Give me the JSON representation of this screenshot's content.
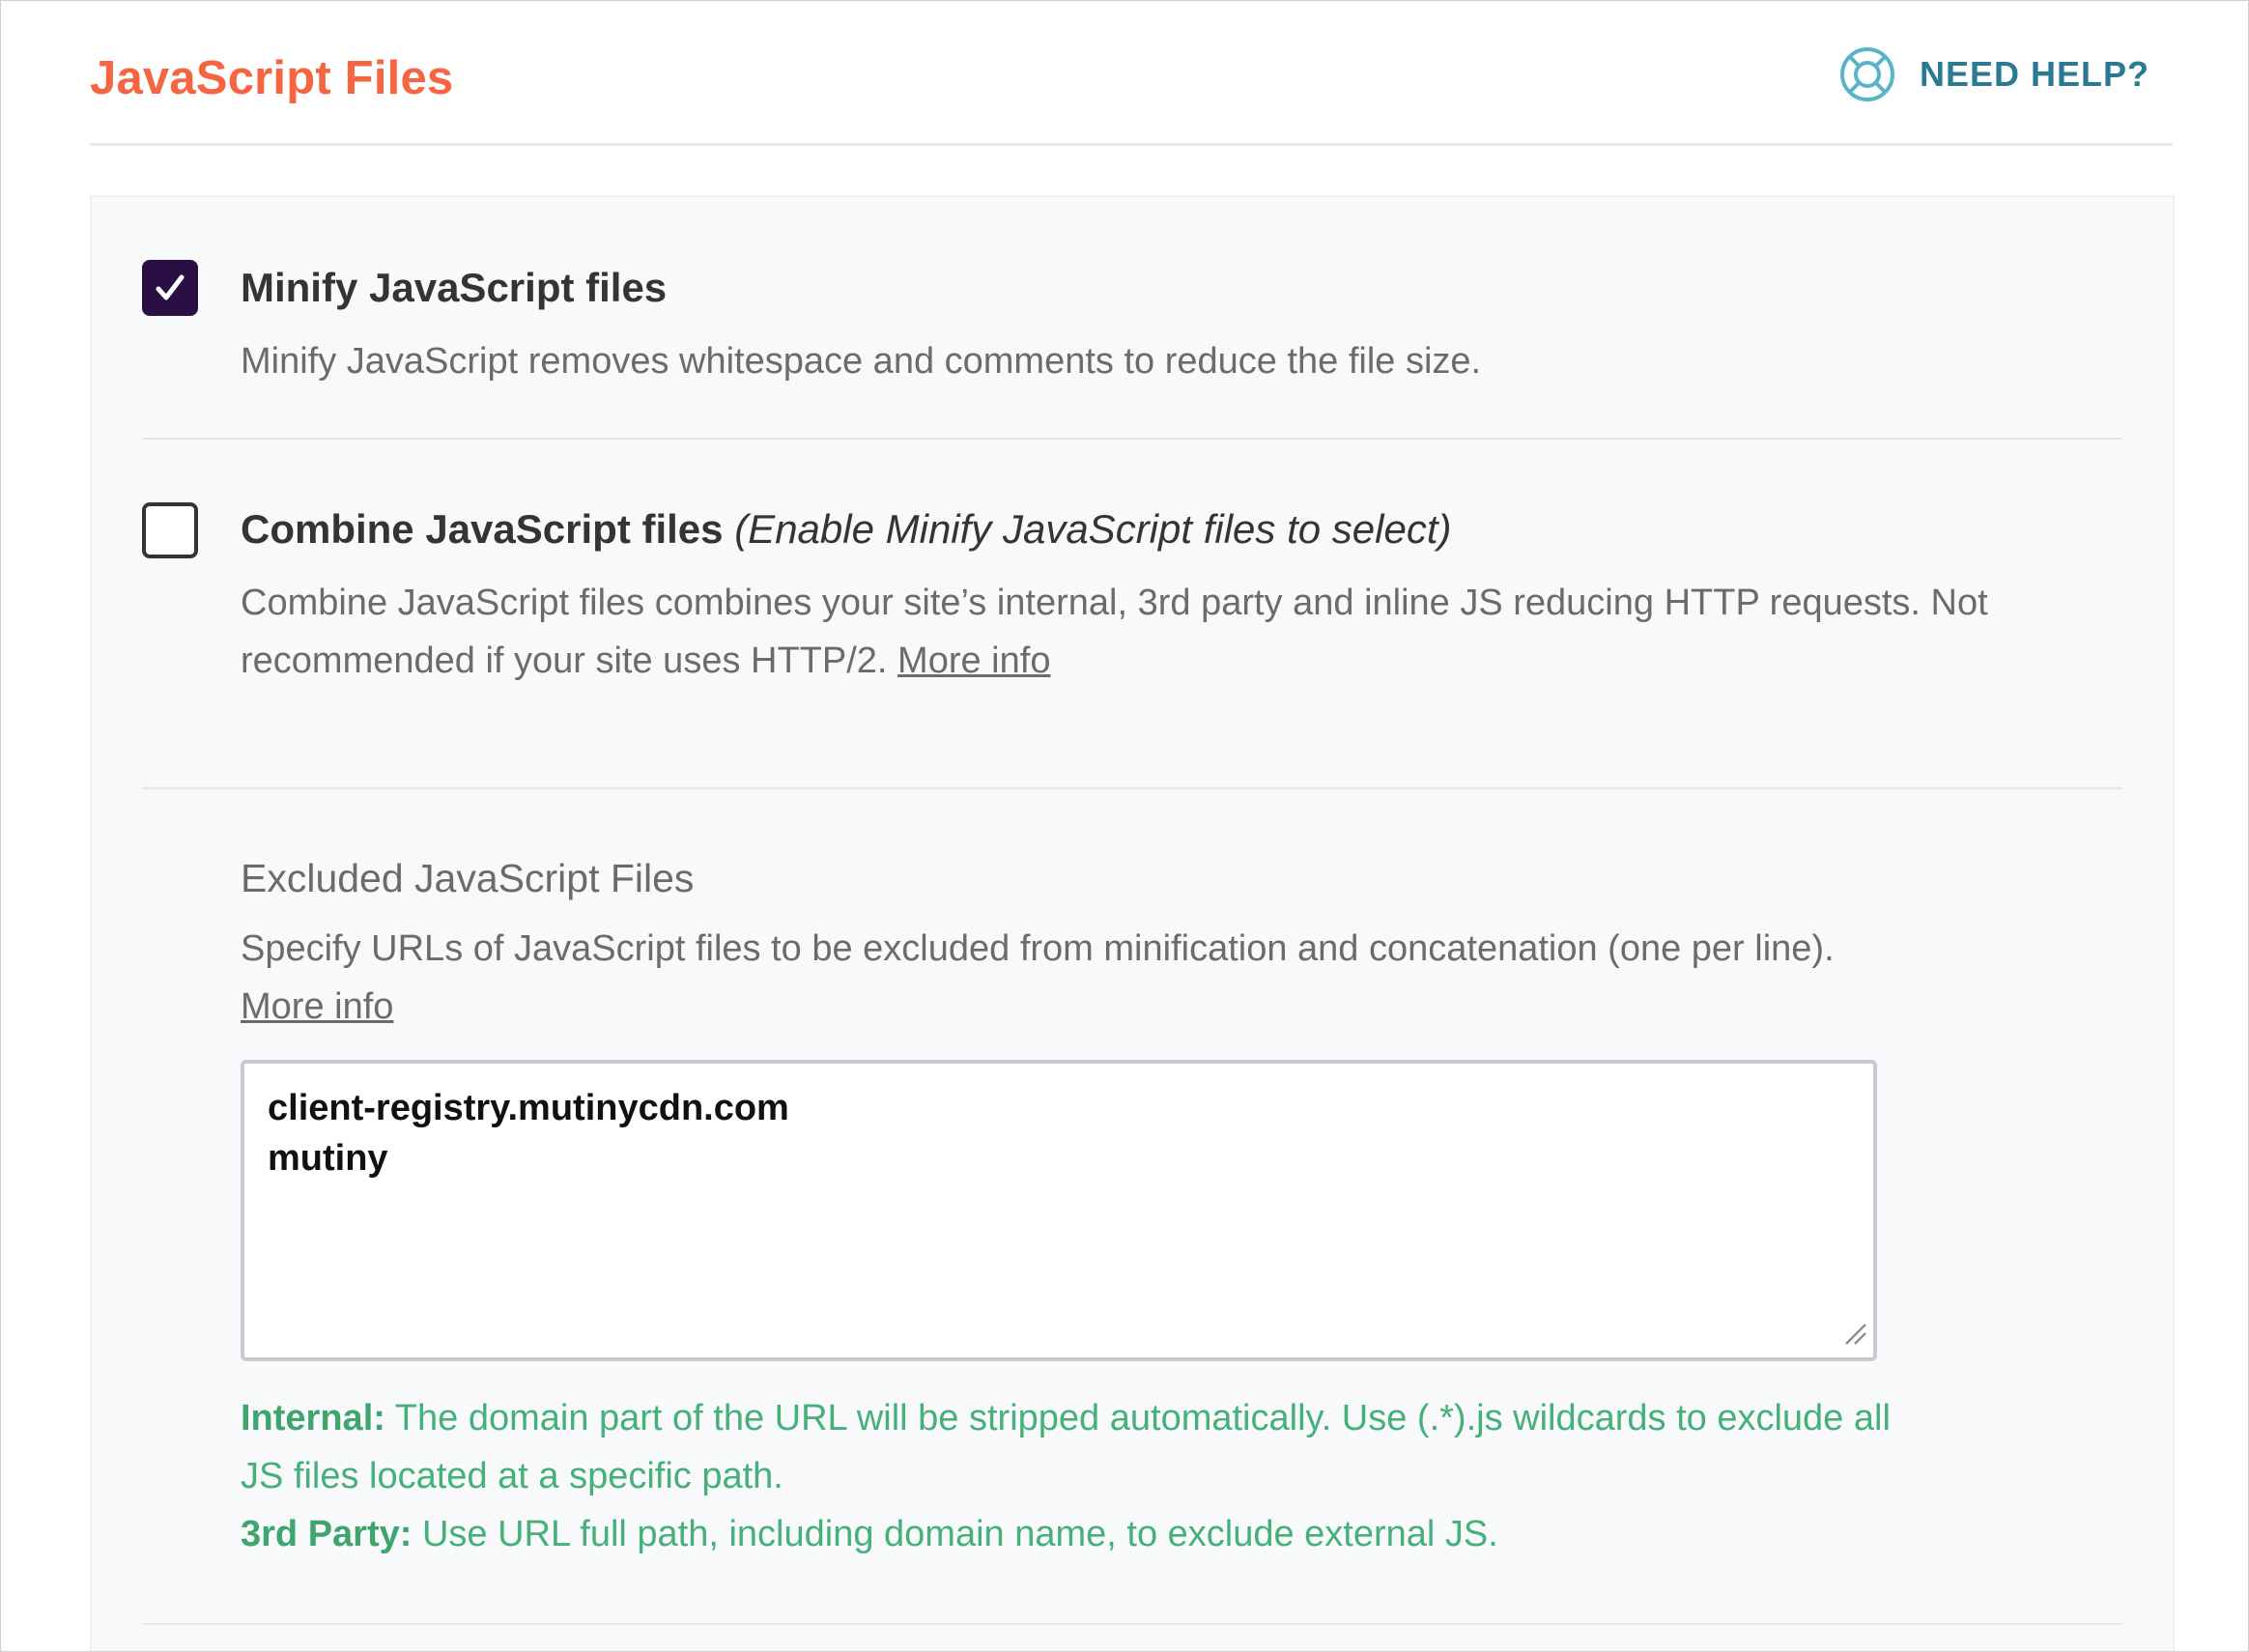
{
  "header": {
    "title": "JavaScript Files",
    "help_label": "NEED HELP?"
  },
  "colors": {
    "accent_title": "#f56640",
    "help": "#2c7a91",
    "checkbox_checked": "#2a0f45",
    "hint_green": "#46b07a"
  },
  "options": {
    "minify": {
      "label": "Minify JavaScript files",
      "description": "Minify JavaScript removes whitespace and comments to reduce the file size.",
      "checked": true
    },
    "combine": {
      "label": "Combine JavaScript files",
      "note": "(Enable Minify JavaScript files to select)",
      "description": "Combine JavaScript files combines your site’s internal, 3rd party and inline JS reducing HTTP requests. Not recommended if your site uses HTTP/2.",
      "link": "More info",
      "checked": false
    }
  },
  "excluded": {
    "label": "Excluded JavaScript Files",
    "description": "Specify URLs of JavaScript files to be excluded from minification and concatenation (one per line).",
    "link": "More info",
    "value": "client-registry.mutinycdn.com\nmutiny",
    "hint_internal_label": "Internal:",
    "hint_internal_text": "The domain part of the URL will be stripped automatically. Use (.*).js wildcards to exclude all JS files located at a specific path.",
    "hint_third_label": "3rd Party:",
    "hint_third_text": "Use URL full path, including domain name, to exclude external JS."
  },
  "icons": {
    "help": "lifebuoy-icon",
    "check": "checkmark-icon",
    "resize": "resize-grip-icon"
  }
}
